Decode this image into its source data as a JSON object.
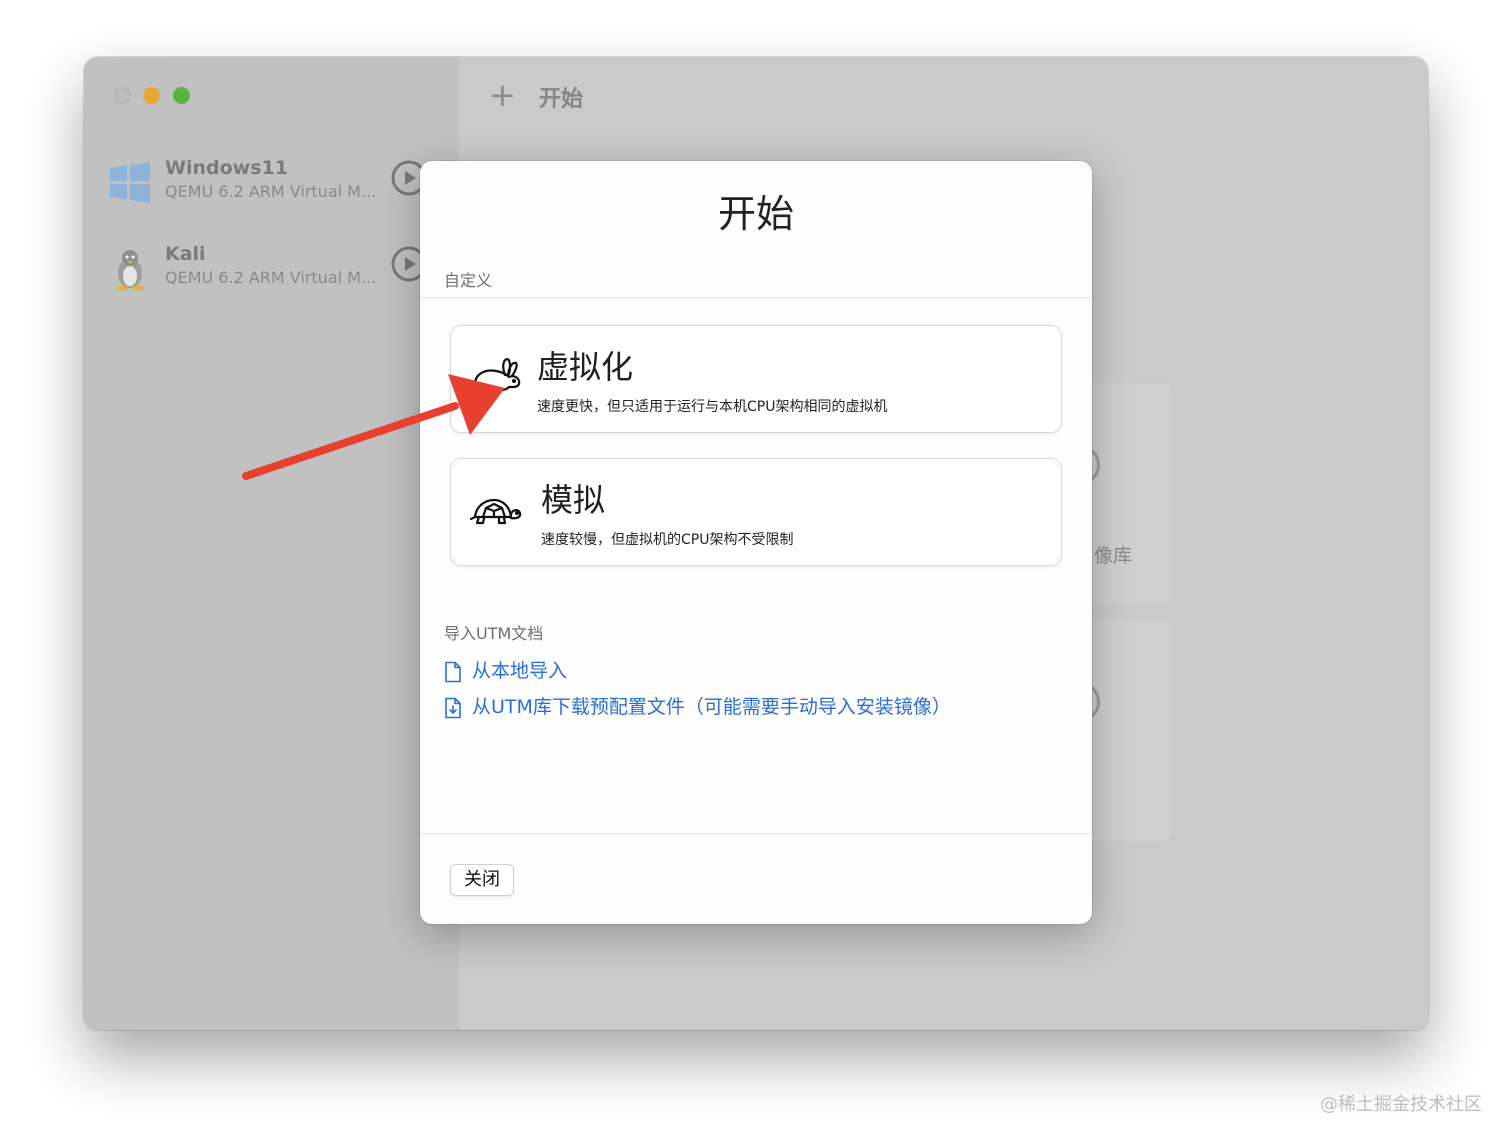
{
  "window": {
    "header_title": "开始",
    "add_symbol": "+"
  },
  "sidebar": {
    "vms": [
      {
        "name": "Windows11",
        "subtitle": "QEMU 6.2 ARM Virtual M...",
        "icon": "windows-logo-icon"
      },
      {
        "name": "Kali",
        "subtitle": "QEMU 6.2 ARM Virtual M...",
        "icon": "linux-penguin-icon"
      }
    ]
  },
  "background": {
    "partial_text": "像库"
  },
  "modal": {
    "title": "开始",
    "custom_label": "自定义",
    "options": [
      {
        "title": "虚拟化",
        "description": "速度更快，但只适用于运行与本机CPU架构相同的虚拟机",
        "icon": "rabbit-icon"
      },
      {
        "title": "模拟",
        "description": "速度较慢，但虚拟机的CPU架构不受限制",
        "icon": "turtle-icon"
      }
    ],
    "import_label": "导入UTM文档",
    "links": [
      {
        "label": "从本地导入",
        "icon": "document-icon"
      },
      {
        "label": "从UTM库下载预配置文件（可能需要手动导入安装镜像）",
        "icon": "document-download-icon"
      }
    ],
    "close_label": "关闭"
  },
  "watermark": "@稀土掘金技术社区",
  "colors": {
    "accent_link": "#2a6fd6",
    "annotation_arrow": "#e8402e"
  }
}
